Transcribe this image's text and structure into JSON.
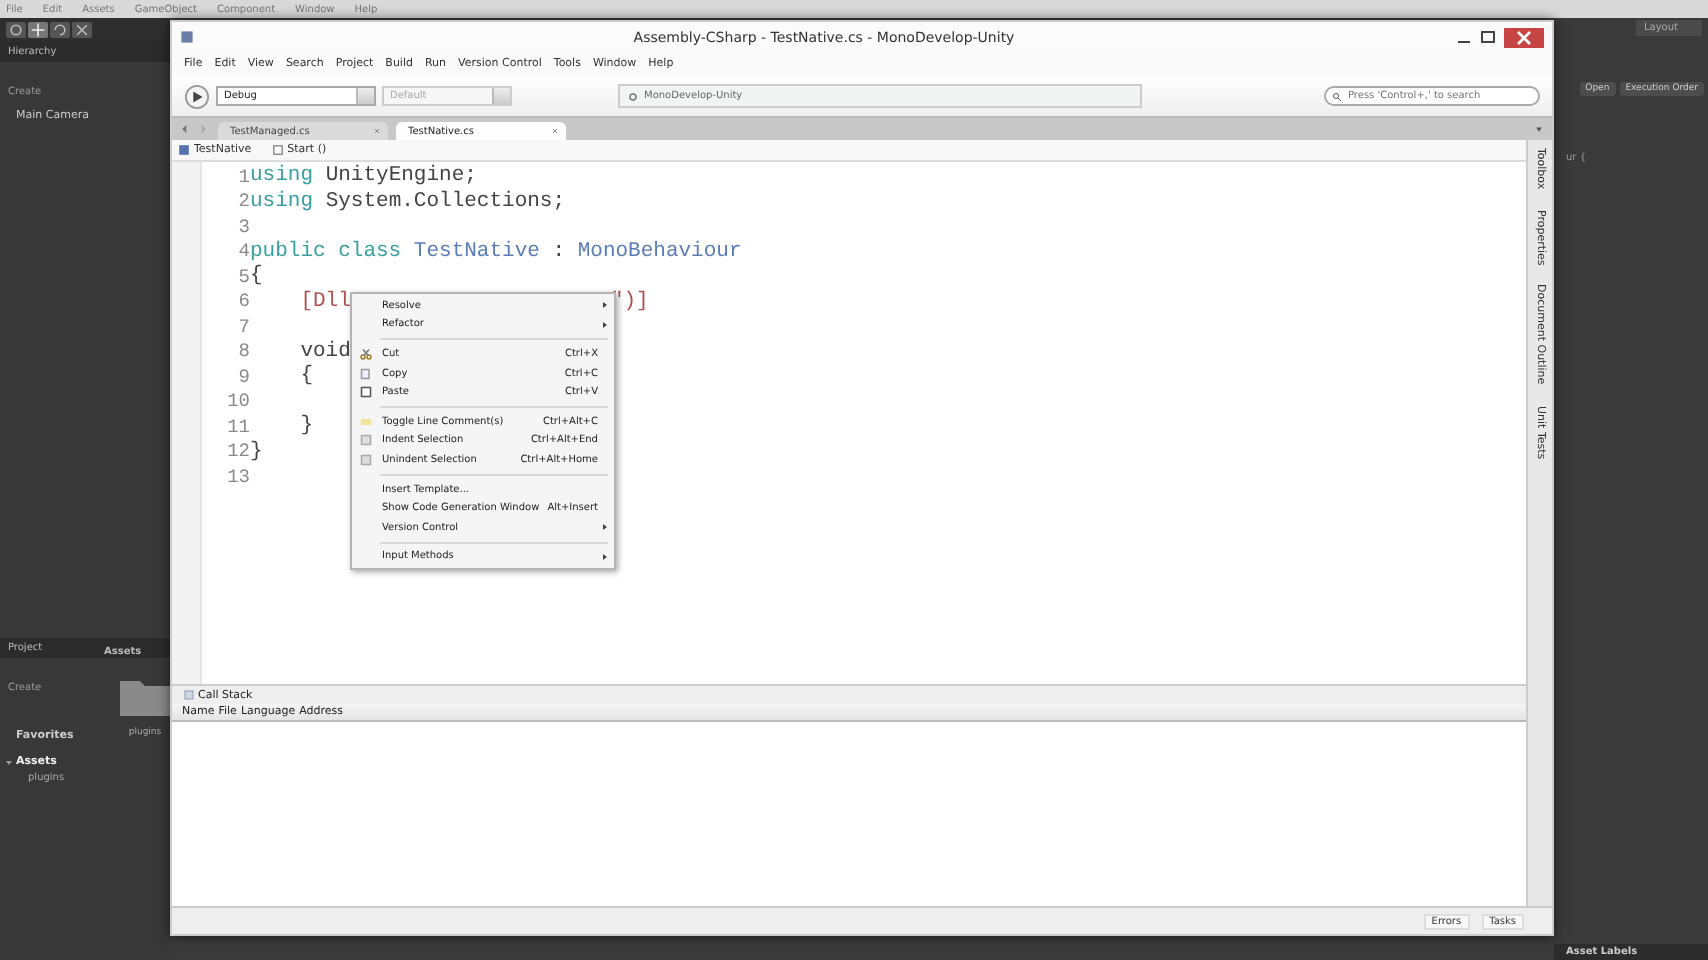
{
  "unity": {
    "menu": [
      "File",
      "Edit",
      "Assets",
      "GameObject",
      "Component",
      "Window",
      "Help"
    ],
    "hierarchy": {
      "title": "Hierarchy",
      "create": "Create",
      "items": [
        "Main Camera"
      ]
    },
    "project": {
      "title": "Project",
      "create": "Create",
      "favorites": "Favorites",
      "assets_heading": "Assets",
      "tree": [
        {
          "label": "Assets",
          "expanded": true,
          "children": [
            {
              "label": "plugins"
            }
          ]
        }
      ],
      "folder_label": "plugins"
    },
    "right": {
      "layout": "Layout",
      "buttons": [
        "Open",
        "Execution Order"
      ],
      "code_fragment": "ur {",
      "asset_labels": "Asset Labels"
    }
  },
  "ide": {
    "title": "Assembly-CSharp - TestNative.cs - MonoDevelop-Unity",
    "menu": [
      "File",
      "Edit",
      "View",
      "Search",
      "Project",
      "Build",
      "Run",
      "Version Control",
      "Tools",
      "Window",
      "Help"
    ],
    "toolbar": {
      "config": "Debug",
      "platform": {
        "label": "Default",
        "disabled": true
      },
      "status": "MonoDevelop-Unity",
      "search_placeholder": "Press 'Control+,' to search"
    },
    "tabs": [
      {
        "label": "TestManaged.cs",
        "selected": false
      },
      {
        "label": "TestNative.cs",
        "selected": true
      }
    ],
    "breadcrumb": [
      "TestNative",
      "Start ()"
    ],
    "code_lines": [
      {
        "number": "1",
        "tokens": [
          {
            "text": "using",
            "kind": "keyword"
          },
          {
            "text": " UnityEngine;",
            "kind": "plain"
          }
        ]
      },
      {
        "number": "2",
        "tokens": [
          {
            "text": "using",
            "kind": "keyword"
          },
          {
            "text": " System.Collections;",
            "kind": "plain"
          }
        ]
      },
      {
        "number": "3"
      },
      {
        "number": "4",
        "tokens": [
          {
            "text": "public class",
            "kind": "keyword"
          },
          {
            "text": " TestNative",
            "kind": "type"
          },
          {
            "text": " : ",
            "kind": "plain"
          },
          {
            "text": "MonoBehaviour",
            "kind": "type"
          }
        ]
      },
      {
        "number": "5",
        "tokens": [
          {
            "text": "{",
            "kind": "plain"
          }
        ]
      },
      {
        "number": "6",
        "tokens": [
          {
            "text": "    [Dll",
            "kind": "attribute"
          },
          {
            "text": "\")]",
            "kind": "after-menu"
          }
        ]
      },
      {
        "number": "7"
      },
      {
        "number": "8",
        "tokens": [
          {
            "text": "    void",
            "kind": "plain"
          }
        ]
      },
      {
        "number": "9",
        "tokens": [
          {
            "text": "    {",
            "kind": "plain"
          }
        ]
      },
      {
        "number": "10"
      },
      {
        "number": "11",
        "tokens": [
          {
            "text": "    }",
            "kind": "plain"
          }
        ]
      },
      {
        "number": "12",
        "tokens": [
          {
            "text": "}",
            "kind": "plain"
          }
        ]
      },
      {
        "number": "13"
      }
    ],
    "dock_tabs": [
      "Toolbox",
      "Properties",
      "Document Outline",
      "Unit Tests"
    ],
    "call_stack": {
      "title": "Call Stack",
      "columns": [
        "Name",
        "File",
        "Language",
        "Address"
      ]
    },
    "status_bar": [
      "Errors",
      "Tasks"
    ]
  },
  "context_menu": [
    {
      "kind": "item",
      "label": "Resolve",
      "submenu": true
    },
    {
      "kind": "item",
      "label": "Refactor",
      "submenu": true
    },
    {
      "kind": "separator"
    },
    {
      "kind": "item",
      "label": "Cut",
      "shortcut": "Ctrl+X",
      "submenu": false
    },
    {
      "kind": "item",
      "label": "Copy",
      "shortcut": "Ctrl+C",
      "submenu": false
    },
    {
      "kind": "item",
      "label": "Paste",
      "shortcut": "Ctrl+V",
      "submenu": false
    },
    {
      "kind": "separator"
    },
    {
      "kind": "item",
      "label": "Toggle Line Comment(s)",
      "shortcut": "Ctrl+Alt+C",
      "submenu": false
    },
    {
      "kind": "item",
      "label": "Indent Selection",
      "shortcut": "Ctrl+Alt+End",
      "submenu": false
    },
    {
      "kind": "item",
      "label": "Unindent Selection",
      "shortcut": "Ctrl+Alt+Home",
      "submenu": false
    },
    {
      "kind": "separator"
    },
    {
      "kind": "item",
      "label": "Insert Template...",
      "submenu": false
    },
    {
      "kind": "item",
      "label": "Show Code Generation Window",
      "shortcut": "Alt+Insert",
      "submenu": false
    },
    {
      "kind": "item",
      "label": "Version Control",
      "submenu": true
    },
    {
      "kind": "separator"
    },
    {
      "kind": "item",
      "label": "Input Methods",
      "submenu": true
    }
  ]
}
